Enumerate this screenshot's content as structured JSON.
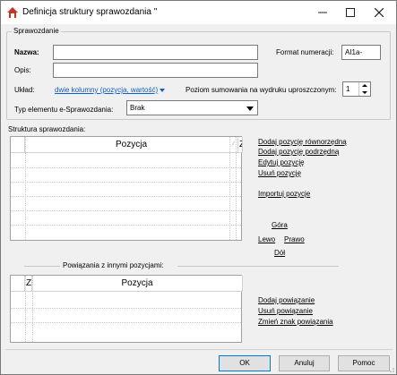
{
  "window": {
    "title": "Definicja struktury sprawozdania ''"
  },
  "sprawozdanie_group": {
    "legend": "Sprawozdanie",
    "nazwa_label": "Nazwa:",
    "nazwa_value": "",
    "opis_label": "Opis:",
    "opis_value": "",
    "format_label": "Format numeracji:",
    "format_value": "AI1a-",
    "uklad_label": "Układ:",
    "uklad_value": "dwie kolumny (pozycja, wartość)",
    "poziom_label": "Poziom sumowania na wydruku uproszczonym:",
    "poziom_value": "1",
    "typ_label": "Typ elementu e-Sprawozdania:",
    "typ_value": "Brak"
  },
  "struktura": {
    "label": "Struktura sprawozdania:",
    "columns": [
      "Pozycja",
      "ZP"
    ]
  },
  "struktura_actions": {
    "dodaj_rownorzedna": "Dodaj pozycję równorzędną",
    "dodaj_podrzedna": "Dodaj pozycję podrzędną",
    "edytuj": "Edytuj pozycję",
    "usun": "Usuń pozycję",
    "importuj": "Importuj pozycje",
    "gora": "Góra",
    "lewo": "Lewo",
    "prawo": "Prawo",
    "dol": "Dół"
  },
  "powiazania": {
    "label": "Powiązania z innymi pozycjami:",
    "columns": [
      "Z",
      "Pozycja"
    ],
    "dodaj": "Dodaj powiązanie",
    "usun": "Usuń powiązanie",
    "zmien": "Zmień znak powiązania"
  },
  "footer": {
    "ok": "OK",
    "anuluj": "Anuluj",
    "pomoc": "Pomoc"
  },
  "colors": {
    "link_blue": "#1060c0",
    "app_icon_red": "#c0392b"
  }
}
